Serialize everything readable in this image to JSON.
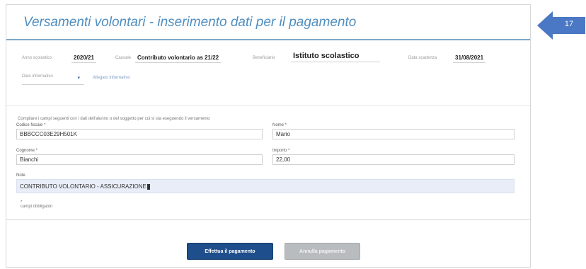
{
  "page": {
    "title": "Versamenti volontari - inserimento dati per il pagamento"
  },
  "summary": {
    "year_label": "Anno scolastico",
    "year_value": "2020/21",
    "cause_label": "Causale",
    "cause_value": "Contributo volontario as 21/22",
    "beneficiary_label": "Beneficiario",
    "beneficiary_value": "Istituto scolastico",
    "due_label": "Data scadenza",
    "due_value": "31/08/2021"
  },
  "options": {
    "select_placeholder": "Dato informativo",
    "link_label": "Allegato informativo"
  },
  "form": {
    "instructions": "Compilare i campi seguenti con i dati dell'alunno o del soggetto per cui si sta eseguendo il versamento",
    "fiscal_code_label": "Codice fiscale *",
    "fiscal_code_value": "BBBCCC03E29H501K",
    "name_label": "Nome *",
    "name_value": "Mario",
    "surname_label": "Cognome *",
    "surname_value": "Bianchi",
    "amount_label": "Importo *",
    "amount_value": "22,00",
    "notes_label": "Note",
    "notes_value": "CONTRIBUTO VOLONTARIO - ASSICURAZIONE",
    "required_star": "*",
    "required_text": "campi obbligatori"
  },
  "actions": {
    "pay_label": "Effettua il pagamento",
    "cancel_label": "Annulla pagamento"
  },
  "badge": {
    "number": "17",
    "color": "#4a78c4"
  }
}
